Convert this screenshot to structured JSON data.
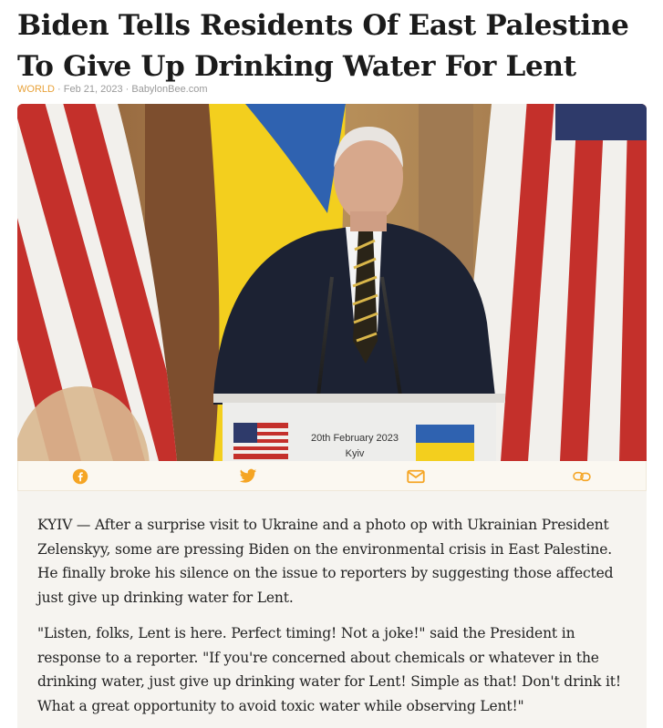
{
  "article": {
    "headline": "Biden Tells Residents Of East Palestine To Give Up Drinking Water For Lent",
    "category": "WORLD",
    "date": "Feb 21, 2023",
    "source": "BabylonBee.com",
    "separator": " · ",
    "image": {
      "podium_line1": "20th February 2023",
      "podium_line2": "Kyiv"
    },
    "paragraphs": [
      "KYIV — After a surprise visit to Ukraine and a photo op with Ukrainian President Zelenskyy, some are pressing Biden on the environmental crisis in East Palestine. He finally broke his silence on the issue to reporters by suggesting those affected just give up drinking water for Lent.",
      "\"Listen, folks, Lent is here. Perfect timing! Not a joke!\" said the President in response to a reporter. \"If you're concerned about chemicals or whatever in the drinking water, just give up drinking water for Lent! Simple as that! Don't drink it! What a great opportunity to avoid toxic water while observing Lent!\""
    ]
  },
  "share": {
    "icons": [
      "facebook-icon",
      "twitter-icon",
      "email-icon",
      "link-icon"
    ]
  },
  "colors": {
    "accent": "#f5a524",
    "category": "#e8a23a",
    "meta": "#9a9a9a"
  }
}
